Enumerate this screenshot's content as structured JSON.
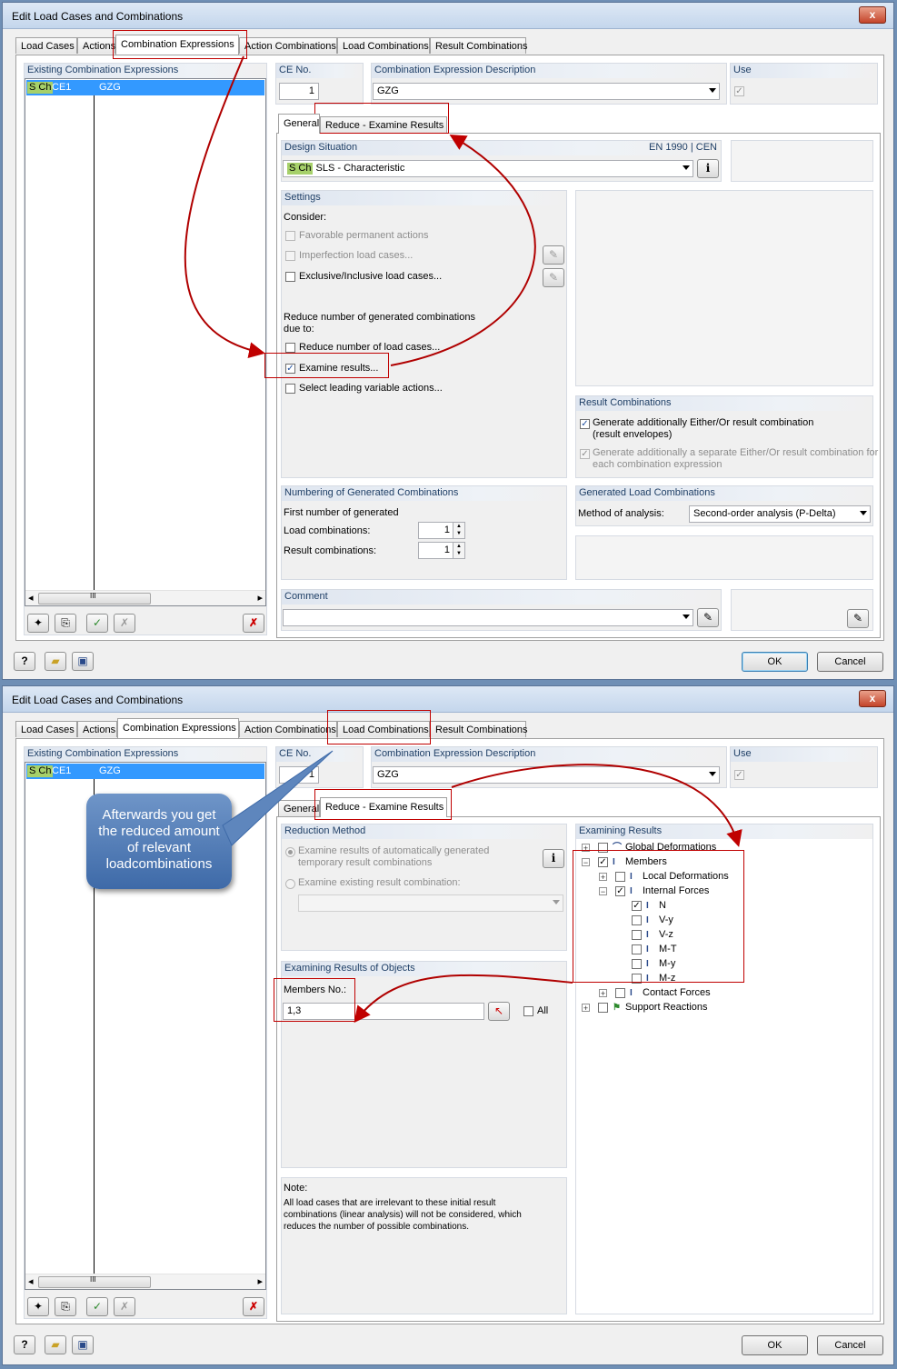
{
  "dialog_title": "Edit Load Cases and Combinations",
  "close_glyph": "x",
  "tabs": [
    "Load Cases",
    "Actions",
    "Combination Expressions",
    "Action Combinations",
    "Load Combinations",
    "Result Combinations"
  ],
  "left_panel": {
    "header": "Existing Combination Expressions",
    "row_badge": "S Ch",
    "row_id": "CE1",
    "row_desc": "GZG",
    "scroll_grip": "III"
  },
  "ce_no": {
    "label": "CE No.",
    "value": "1"
  },
  "ce_desc": {
    "label": "Combination Expression Description",
    "value": "GZG"
  },
  "use": {
    "label": "Use"
  },
  "subtabs": [
    "General",
    "Reduce - Examine Results"
  ],
  "design_situation": {
    "label": "Design Situation",
    "standard": "EN 1990 | CEN",
    "badge": "S Ch",
    "value": "SLS - Characteristic"
  },
  "settings": {
    "label": "Settings",
    "consider": "Consider:",
    "favorable": "Favorable permanent actions",
    "imperfection": "Imperfection load cases...",
    "exclusive": "Exclusive/Inclusive load cases...",
    "reduce_text_1": "Reduce number of generated combinations",
    "reduce_text_2": "due to:",
    "reduce_lc": "Reduce number of load cases...",
    "examine": "Examine results...",
    "leading": "Select leading variable actions..."
  },
  "result_combinations": {
    "label": "Result Combinations",
    "opt1_a": "Generate additionally Either/Or result combination",
    "opt1_b": "(result envelopes)",
    "opt2_a": "Generate additionally a separate Either/Or result combination for",
    "opt2_b": "each combination expression"
  },
  "numbering": {
    "label": "Numbering of Generated Combinations",
    "first": "First number of generated",
    "lc_label": "Load combinations:",
    "lc_value": "1",
    "rc_label": "Result combinations:",
    "rc_value": "1"
  },
  "generated": {
    "label": "Generated Load Combinations",
    "method_label": "Method of analysis:",
    "method_value": "Second-order analysis (P-Delta)"
  },
  "comment": {
    "label": "Comment"
  },
  "buttons": {
    "ok": "OK",
    "cancel": "Cancel"
  },
  "reduction_method": {
    "label": "Reduction Method",
    "opt1_a": "Examine results of automatically generated",
    "opt1_b": "temporary result combinations",
    "opt2": "Examine existing result combination:"
  },
  "examining_objects": {
    "label": "Examining Results of Objects",
    "members_label": "Members No.:",
    "members_value": "1,3",
    "all_label": "All"
  },
  "note": {
    "title": "Note:",
    "l1": "All load cases that are irrelevant to these initial result",
    "l2": "combinations (linear analysis) will not be considered, which",
    "l3": "reduces the number of possible combinations."
  },
  "examining_results": {
    "label": "Examining Results",
    "global": "Global Deformations",
    "members": "Members",
    "local": "Local Deformations",
    "internal": "Internal Forces",
    "n": "N",
    "vy": "V-y",
    "vz": "V-z",
    "mt": "M-T",
    "my": "M-y",
    "mz": "M-z",
    "contact": "Contact Forces",
    "support": "Support Reactions"
  },
  "callout": {
    "l1": "Afterwards you get",
    "l2": "the reduced amount",
    "l3": "of relevant",
    "l4": "loadcombinations"
  },
  "icons": {
    "info": "i",
    "check": "✓",
    "cross": "✗",
    "plus": "+",
    "minus": "−",
    "scroll_left": "◂",
    "scroll_right": "▸",
    "spin_up": "▲",
    "spin_down": "▼",
    "help": "?",
    "pick": "↖",
    "edit": "✎"
  },
  "colors": {
    "accent": "#3399ff",
    "highlight": "#c00000",
    "badge": "#a6d06a"
  }
}
